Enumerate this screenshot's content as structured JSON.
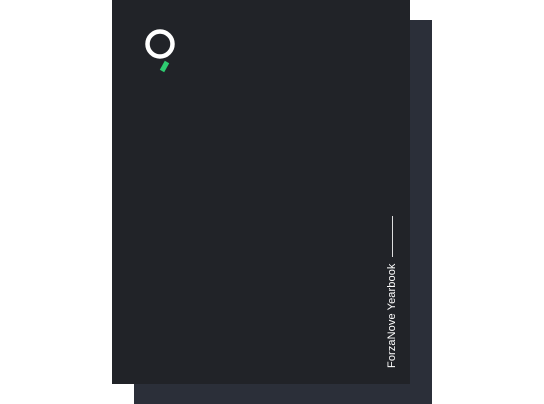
{
  "cover": {
    "title": "ForzaNove Yearbook",
    "logo_icon": "magnifier-logo-icon"
  },
  "colors": {
    "page_background": "#ffffff",
    "front_cover": "#212328",
    "back_cover": "#2b2f39",
    "logo_ring": "#ffffff",
    "logo_accent": "#2ecc71",
    "text": "#ffffff"
  }
}
